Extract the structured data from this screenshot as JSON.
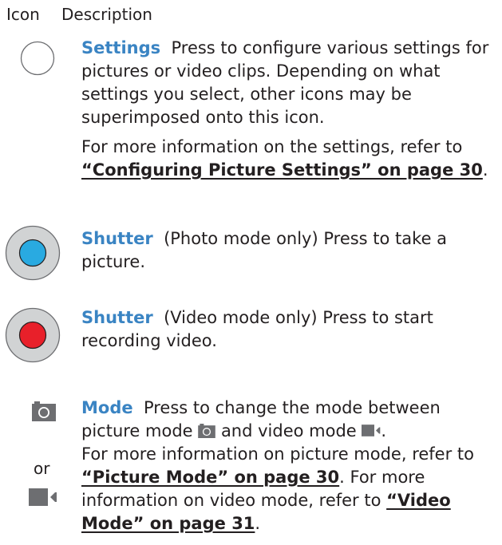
{
  "header": {
    "icon_col": "Icon",
    "desc_col": "Description"
  },
  "rows": [
    {
      "icon": "settings-circle-icon",
      "term": "Settings",
      "text": "Press to configure various settings for pictures or video clips. Depending on what settings you select, other icons may be superimposed onto this icon.",
      "more_prefix": "For more information on the settings, refer to ",
      "more_link": "“Configuring Picture Settings” on page 30",
      "more_suffix": "."
    },
    {
      "icon": "shutter-photo-icon",
      "term": "Shutter",
      "text": "(Photo mode only) Press to take a picture."
    },
    {
      "icon": "shutter-video-icon",
      "term": "Shutter",
      "text": "(Video mode only) Press to start recording video."
    },
    {
      "icon": "mode-icon",
      "term": "Mode",
      "text_a": "Press to change the mode between picture mode ",
      "text_b": " and video mode ",
      "text_c": ".",
      "or_label": "or",
      "more1_prefix": "For more information on picture mode, refer to ",
      "more1_link": "“Picture Mode” on page 30",
      "more1_suffix": ". For more information on video mode, refer to ",
      "more2_link": "“Video Mode” on page 31",
      "more2_suffix": "."
    }
  ],
  "colors": {
    "term": "#3a84c3",
    "shutter_photo": "#29aae1",
    "shutter_video": "#e8202a",
    "icon_gray": "#6d6e71"
  }
}
